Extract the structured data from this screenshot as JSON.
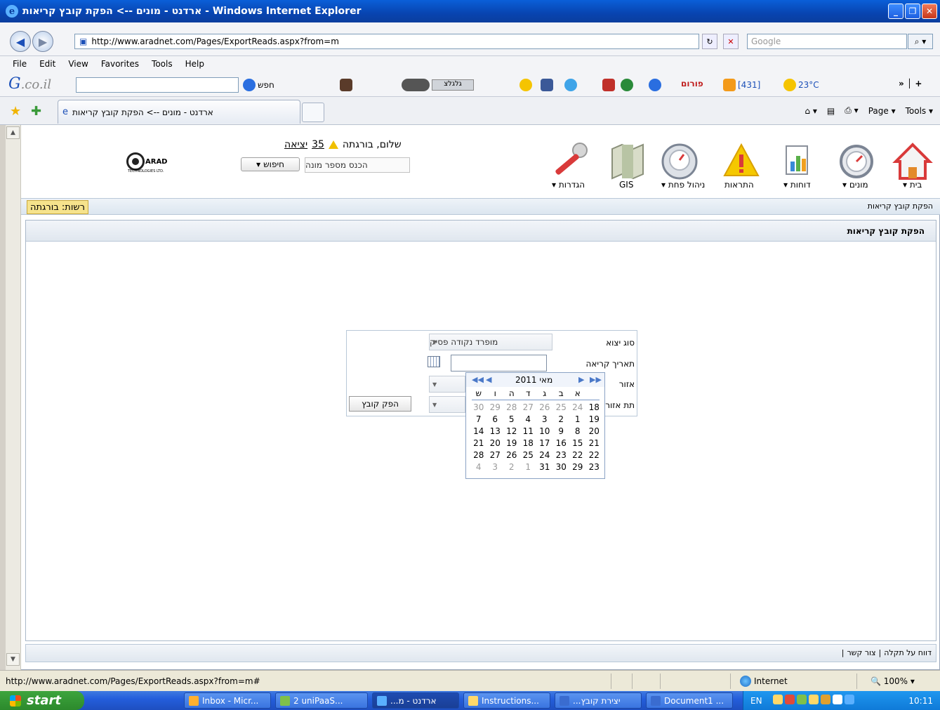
{
  "window": {
    "title": "ארדנט - מונים --> הפקת קובץ קריאות - Windows Internet Explorer",
    "minimize": "_",
    "maximize": "❐",
    "close": "✕"
  },
  "address": {
    "back": "◀",
    "forward": "▶",
    "url": "http://www.aradnet.com/Pages/ExportReads.aspx?from=m",
    "refresh": "↻",
    "stop": "✕",
    "search_placeholder": "Google",
    "search_icon": "search-icon"
  },
  "menu": [
    "File",
    "Edit",
    "View",
    "Favorites",
    "Tools",
    "Help"
  ],
  "gco": {
    "logo_g": "G",
    "logo_rest": ".co.il",
    "search_label": "חפש",
    "channels": "גלגלצ",
    "portal": "פורום",
    "count": "[431]",
    "weather": "23°C"
  },
  "tabs": {
    "active_title": "ארדנט - מונים --> הפקת קובץ קריאות",
    "commands": [
      "Page",
      "Tools"
    ]
  },
  "app": {
    "logo_text": "ARAD",
    "logo_sub": "TECHNOLOGIES LTD.",
    "greeting": "שלום, בורגתה",
    "alert_count": "35",
    "logout": "יציאה",
    "search_button": "חיפוש",
    "meter_placeholder": "הכנס מספר מונה",
    "nav": [
      {
        "label": "בית ▾"
      },
      {
        "label": "מונים ▾"
      },
      {
        "label": "דוחות ▾"
      },
      {
        "label": "התראות"
      },
      {
        "label": "ניהול פחת ▾"
      },
      {
        "label": "GIS"
      },
      {
        "label": "הגדרות ▾"
      }
    ],
    "authority": "רשות: בורגתה",
    "breadcrumb": "הפקת קובץ קריאות",
    "panel_title": "הפקת קובץ קריאות"
  },
  "form": {
    "export_type_label": "סוג יצוא",
    "export_type_value": "מופרד נקודה פסיק",
    "read_date_label": "תאריך קריאה",
    "area_label": "אזור",
    "subarea_label": "תת אזור",
    "make_file": "הפק קובץ"
  },
  "calendar": {
    "title": "מאי 2011",
    "weekdays": [
      "ש",
      "ו",
      "ה",
      "ד",
      "ג",
      "ב",
      "א",
      ""
    ],
    "rows": [
      [
        "30",
        "29",
        "28",
        "27",
        "26",
        "25",
        "24",
        "18"
      ],
      [
        "7",
        "6",
        "5",
        "4",
        "3",
        "2",
        "1",
        "19"
      ],
      [
        "14",
        "13",
        "12",
        "11",
        "10",
        "9",
        "8",
        "20"
      ],
      [
        "21",
        "20",
        "19",
        "18",
        "17",
        "16",
        "15",
        "21"
      ],
      [
        "28",
        "27",
        "26",
        "25",
        "24",
        "23",
        "22",
        "22"
      ],
      [
        "4",
        "3",
        "2",
        "1",
        "31",
        "30",
        "29",
        "23"
      ]
    ]
  },
  "footer": {
    "report": "דווח על תקלה",
    "contact": "צור קשר",
    "sep": "|"
  },
  "status": {
    "url": "http://www.aradnet.com/Pages/ExportReads.aspx?from=m#",
    "zone": "Internet",
    "zoom": "100%"
  },
  "taskbar": {
    "start": "start",
    "items": [
      "Inbox - Micr...",
      "2 uniPaaS...",
      "ארדנט - מ...",
      "Instructions...",
      "יצירת קובץ...",
      "Document1 ..."
    ],
    "lang": "EN",
    "clock": "10:11"
  }
}
